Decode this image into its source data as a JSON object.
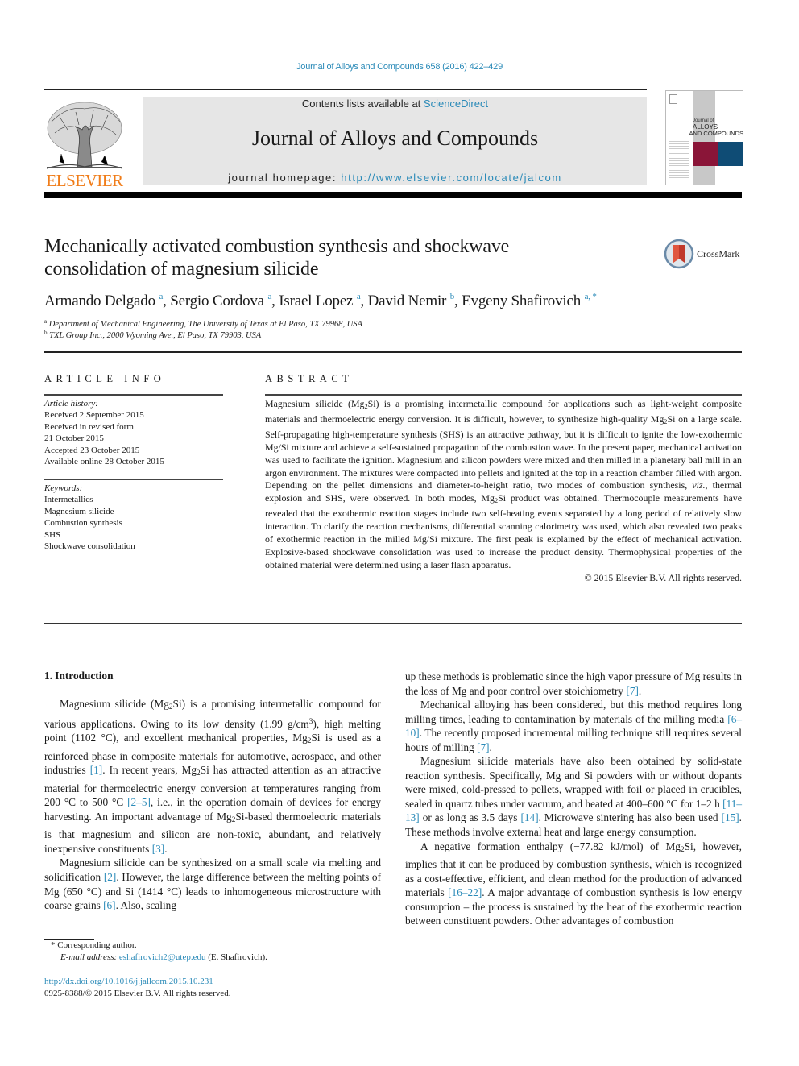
{
  "header": {
    "citation": "Journal of Alloys and Compounds 658 (2016) 422–429",
    "contents_prefix": "Contents lists available at ",
    "contents_link": "ScienceDirect",
    "journal_name": "Journal of Alloys and Compounds",
    "homepage_prefix": "journal homepage: ",
    "homepage_url": "http://www.elsevier.com/locate/jalcom",
    "publisher_wordmark": "ELSEVIER",
    "cover": {
      "line1": "Journal of",
      "line2": "ALLOYS",
      "line3": "AND COMPOUNDS",
      "colors": {
        "left_block": "#8a1538",
        "right_block": "#0f4c75",
        "gray_band": "#c8c8c8"
      }
    }
  },
  "article": {
    "title_line1": "Mechanically activated combustion synthesis and shockwave",
    "title_line2": "consolidation of magnesium silicide",
    "crossmark_label": "CrossMark",
    "authors": [
      {
        "name": "Armando Delgado",
        "aff": "a"
      },
      {
        "name": "Sergio Cordova",
        "aff": "a"
      },
      {
        "name": "Israel Lopez",
        "aff": "a"
      },
      {
        "name": "David Nemir",
        "aff": "b"
      },
      {
        "name": "Evgeny Shafirovich",
        "aff": "a, *"
      }
    ],
    "affiliations": [
      {
        "key": "a",
        "text": "Department of Mechanical Engineering, The University of Texas at El Paso, TX 79968, USA"
      },
      {
        "key": "b",
        "text": "TXL Group Inc., 2000 Wyoming Ave., El Paso, TX 79903, USA"
      }
    ]
  },
  "article_info": {
    "heading": "ARTICLE INFO",
    "history_label": "Article history:",
    "history": [
      "Received 2 September 2015",
      "Received in revised form",
      "21 October 2015",
      "Accepted 23 October 2015",
      "Available online 28 October 2015"
    ],
    "keywords_label": "Keywords:",
    "keywords": [
      "Intermetallics",
      "Magnesium silicide",
      "Combustion synthesis",
      "SHS",
      "Shockwave consolidation"
    ]
  },
  "abstract": {
    "heading": "ABSTRACT",
    "s1a": "Magnesium silicide (Mg",
    "s1b": "Si) is a promising intermetallic compound for applications such as light-weight composite materials and thermoelectric energy conversion. It is difficult, however, to synthesize high-quality Mg",
    "s1c": "Si on a large scale. Self-propagating high-temperature synthesis (SHS) is an attractive pathway, but it is difficult to ignite the low-exothermic Mg/Si mixture and achieve a self-sustained propagation of the combustion wave. In the present paper, mechanical activation was used to facilitate the ignition. Magnesium and silicon powders were mixed and then milled in a planetary ball mill in an argon environment. The mixtures were compacted into pellets and ignited at the top in a reaction chamber filled with argon. Depending on the pellet dimensions and diameter-to-height ratio, two modes of combustion synthesis, ",
    "viz": "viz.",
    "s1d": ", thermal explosion and SHS, were observed. In both modes, Mg",
    "s1e": "Si product was obtained. Thermocouple measurements have revealed that the exothermic reaction stages include two self-heating events separated by a long period of relatively slow interaction. To clarify the reaction mechanisms, differential scanning calorimetry was used, which also revealed two peaks of exothermic reaction in the milled Mg/Si mixture. The first peak is explained by the effect of mechanical activation. Explosive-based shockwave consolidation was used to increase the product density. Thermophysical properties of the obtained material were determined using a laser flash apparatus.",
    "sub2": "2",
    "copyright": "© 2015 Elsevier B.V. All rights reserved."
  },
  "body": {
    "section_heading": "1.  Introduction",
    "sub2": "2",
    "sup3": "3",
    "p1": {
      "a": "Magnesium silicide (Mg",
      "b": "Si) is a promising intermetallic compound for various applications. Owing to its low density (1.99 g/cm",
      "c": "), high melting point (1102 °C), and excellent mechanical properties, Mg",
      "d": "Si is used as a reinforced phase in composite materials for automotive, aerospace, and other industries ",
      "ref1": "[1]",
      "e": ". In recent years, Mg",
      "f": "Si has attracted attention as an attractive material for thermoelectric energy conversion at temperatures ranging from 200 °C to 500 °C ",
      "ref2": "[2–5]",
      "g": ", i.e., in the operation domain of devices for energy harvesting. An important advantage of Mg",
      "h": "Si-based thermoelectric materials is that magnesium and silicon are non-toxic, abundant, and relatively inexpensive constituents ",
      "ref3": "[3]",
      "i": "."
    },
    "p2": {
      "a": "Magnesium silicide can be synthesized on a small scale via melting and solidification ",
      "ref1": "[2]",
      "b": ". However, the large difference between the melting points of Mg (650 °C) and Si (1414 °C) leads to inhomogeneous microstructure with coarse grains ",
      "ref2": "[6]",
      "c": ". Also, scaling up these methods is problematic since the high vapor pressure of Mg results in the loss of Mg and poor control over stoichiometry ",
      "ref3": "[7]",
      "d": "."
    },
    "p3": {
      "a": "Mechanical alloying has been considered, but this method requires long milling times, leading to contamination by materials of the milling media ",
      "ref1": "[6–10]",
      "b": ". The recently proposed incremental milling technique still requires several hours of milling ",
      "ref2": "[7]",
      "c": "."
    },
    "p4": {
      "a": "Magnesium silicide materials have also been obtained by solid-state reaction synthesis. Specifically, Mg and Si powders with or without dopants were mixed, cold-pressed to pellets, wrapped with foil or placed in crucibles, sealed in quartz tubes under vacuum, and heated at 400–600 °C for 1–2 h ",
      "ref1": "[11–13]",
      "b": " or as long as 3.5 days ",
      "ref2": "[14]",
      "c": ". Microwave sintering has also been used ",
      "ref3": "[15]",
      "d": ". These methods involve external heat and large energy consumption."
    },
    "p5": {
      "a": "A negative formation enthalpy (−77.82 kJ/mol) of Mg",
      "b": "Si, however, implies that it can be produced by combustion synthesis, which is recognized as a cost-effective, efficient, and clean method for the production of advanced materials ",
      "ref1": "[16–22]",
      "c": ". A major advantage of combustion synthesis is low energy consumption – the process is sustained by the heat of the exothermic reaction between constituent powders. Other advantages of combustion"
    }
  },
  "footnotes": {
    "star": "*",
    "corresponding": "Corresponding author.",
    "email_label": "E-mail address:",
    "email": "eshafirovich2@utep.edu",
    "email_suffix": " (E. Shafirovich).",
    "doi": "http://dx.doi.org/10.1016/j.jallcom.2015.10.231",
    "issn_line": "0925-8388/© 2015 Elsevier B.V. All rights reserved."
  },
  "colors": {
    "link": "#2a8ab8",
    "elsevier_orange": "#f07d1a",
    "masthead_gray": "#e6e6e6"
  }
}
